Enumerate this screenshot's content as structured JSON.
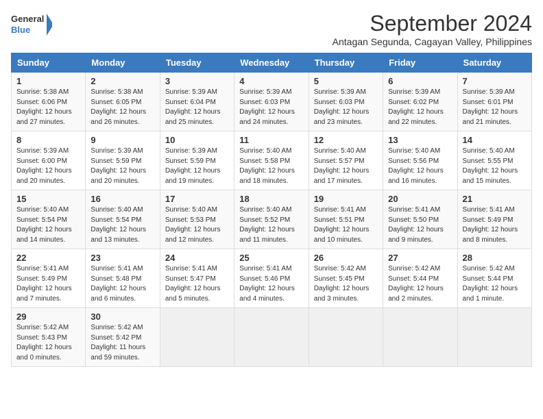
{
  "logo": {
    "line1": "General",
    "line2": "Blue"
  },
  "title": "September 2024",
  "subtitle": "Antagan Segunda, Cagayan Valley, Philippines",
  "headers": [
    "Sunday",
    "Monday",
    "Tuesday",
    "Wednesday",
    "Thursday",
    "Friday",
    "Saturday"
  ],
  "weeks": [
    [
      {
        "day": "1",
        "sunrise": "5:38 AM",
        "sunset": "6:06 PM",
        "daylight": "12 hours and 27 minutes."
      },
      {
        "day": "2",
        "sunrise": "5:38 AM",
        "sunset": "6:05 PM",
        "daylight": "12 hours and 26 minutes."
      },
      {
        "day": "3",
        "sunrise": "5:39 AM",
        "sunset": "6:04 PM",
        "daylight": "12 hours and 25 minutes."
      },
      {
        "day": "4",
        "sunrise": "5:39 AM",
        "sunset": "6:03 PM",
        "daylight": "12 hours and 24 minutes."
      },
      {
        "day": "5",
        "sunrise": "5:39 AM",
        "sunset": "6:03 PM",
        "daylight": "12 hours and 23 minutes."
      },
      {
        "day": "6",
        "sunrise": "5:39 AM",
        "sunset": "6:02 PM",
        "daylight": "12 hours and 22 minutes."
      },
      {
        "day": "7",
        "sunrise": "5:39 AM",
        "sunset": "6:01 PM",
        "daylight": "12 hours and 21 minutes."
      }
    ],
    [
      {
        "day": "8",
        "sunrise": "5:39 AM",
        "sunset": "6:00 PM",
        "daylight": "12 hours and 20 minutes."
      },
      {
        "day": "9",
        "sunrise": "5:39 AM",
        "sunset": "5:59 PM",
        "daylight": "12 hours and 20 minutes."
      },
      {
        "day": "10",
        "sunrise": "5:39 AM",
        "sunset": "5:59 PM",
        "daylight": "12 hours and 19 minutes."
      },
      {
        "day": "11",
        "sunrise": "5:40 AM",
        "sunset": "5:58 PM",
        "daylight": "12 hours and 18 minutes."
      },
      {
        "day": "12",
        "sunrise": "5:40 AM",
        "sunset": "5:57 PM",
        "daylight": "12 hours and 17 minutes."
      },
      {
        "day": "13",
        "sunrise": "5:40 AM",
        "sunset": "5:56 PM",
        "daylight": "12 hours and 16 minutes."
      },
      {
        "day": "14",
        "sunrise": "5:40 AM",
        "sunset": "5:55 PM",
        "daylight": "12 hours and 15 minutes."
      }
    ],
    [
      {
        "day": "15",
        "sunrise": "5:40 AM",
        "sunset": "5:54 PM",
        "daylight": "12 hours and 14 minutes."
      },
      {
        "day": "16",
        "sunrise": "5:40 AM",
        "sunset": "5:54 PM",
        "daylight": "12 hours and 13 minutes."
      },
      {
        "day": "17",
        "sunrise": "5:40 AM",
        "sunset": "5:53 PM",
        "daylight": "12 hours and 12 minutes."
      },
      {
        "day": "18",
        "sunrise": "5:40 AM",
        "sunset": "5:52 PM",
        "daylight": "12 hours and 11 minutes."
      },
      {
        "day": "19",
        "sunrise": "5:41 AM",
        "sunset": "5:51 PM",
        "daylight": "12 hours and 10 minutes."
      },
      {
        "day": "20",
        "sunrise": "5:41 AM",
        "sunset": "5:50 PM",
        "daylight": "12 hours and 9 minutes."
      },
      {
        "day": "21",
        "sunrise": "5:41 AM",
        "sunset": "5:49 PM",
        "daylight": "12 hours and 8 minutes."
      }
    ],
    [
      {
        "day": "22",
        "sunrise": "5:41 AM",
        "sunset": "5:49 PM",
        "daylight": "12 hours and 7 minutes."
      },
      {
        "day": "23",
        "sunrise": "5:41 AM",
        "sunset": "5:48 PM",
        "daylight": "12 hours and 6 minutes."
      },
      {
        "day": "24",
        "sunrise": "5:41 AM",
        "sunset": "5:47 PM",
        "daylight": "12 hours and 5 minutes."
      },
      {
        "day": "25",
        "sunrise": "5:41 AM",
        "sunset": "5:46 PM",
        "daylight": "12 hours and 4 minutes."
      },
      {
        "day": "26",
        "sunrise": "5:42 AM",
        "sunset": "5:45 PM",
        "daylight": "12 hours and 3 minutes."
      },
      {
        "day": "27",
        "sunrise": "5:42 AM",
        "sunset": "5:44 PM",
        "daylight": "12 hours and 2 minutes."
      },
      {
        "day": "28",
        "sunrise": "5:42 AM",
        "sunset": "5:44 PM",
        "daylight": "12 hours and 1 minute."
      }
    ],
    [
      {
        "day": "29",
        "sunrise": "5:42 AM",
        "sunset": "5:43 PM",
        "daylight": "12 hours and 0 minutes."
      },
      {
        "day": "30",
        "sunrise": "5:42 AM",
        "sunset": "5:42 PM",
        "daylight": "11 hours and 59 minutes."
      },
      null,
      null,
      null,
      null,
      null
    ]
  ]
}
